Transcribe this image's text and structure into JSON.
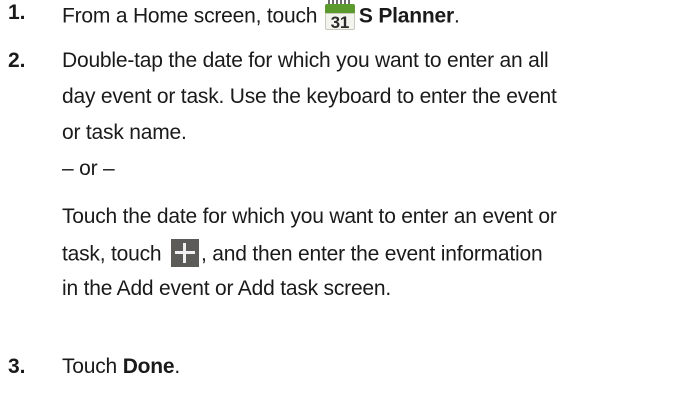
{
  "steps": [
    {
      "number": "1.",
      "lines": [
        {
          "before": "From a Home screen, touch ",
          "icon": "calendar-icon",
          "icon_label": "31",
          "bold": "S Planner",
          "after": "."
        }
      ]
    },
    {
      "number": "2.",
      "lines": [
        "Double-tap the date for which you want to enter an all",
        "day event or task. Use the keyboard to enter the event",
        "or task name.",
        "– or –",
        "Touch the date for which you want to enter an event or",
        {
          "before": "task, touch ",
          "icon": "plus-icon",
          "after": ", and then enter the event information"
        },
        "in the Add event or Add task screen."
      ]
    },
    {
      "number": "3.",
      "lines": [
        {
          "before": "Touch ",
          "bold": "Done",
          "after": "."
        }
      ]
    }
  ],
  "colors": {
    "text": "#1a1a1a",
    "calendar_green": "#5b9b2d",
    "plus_icon_bg": "#5d5b57"
  }
}
